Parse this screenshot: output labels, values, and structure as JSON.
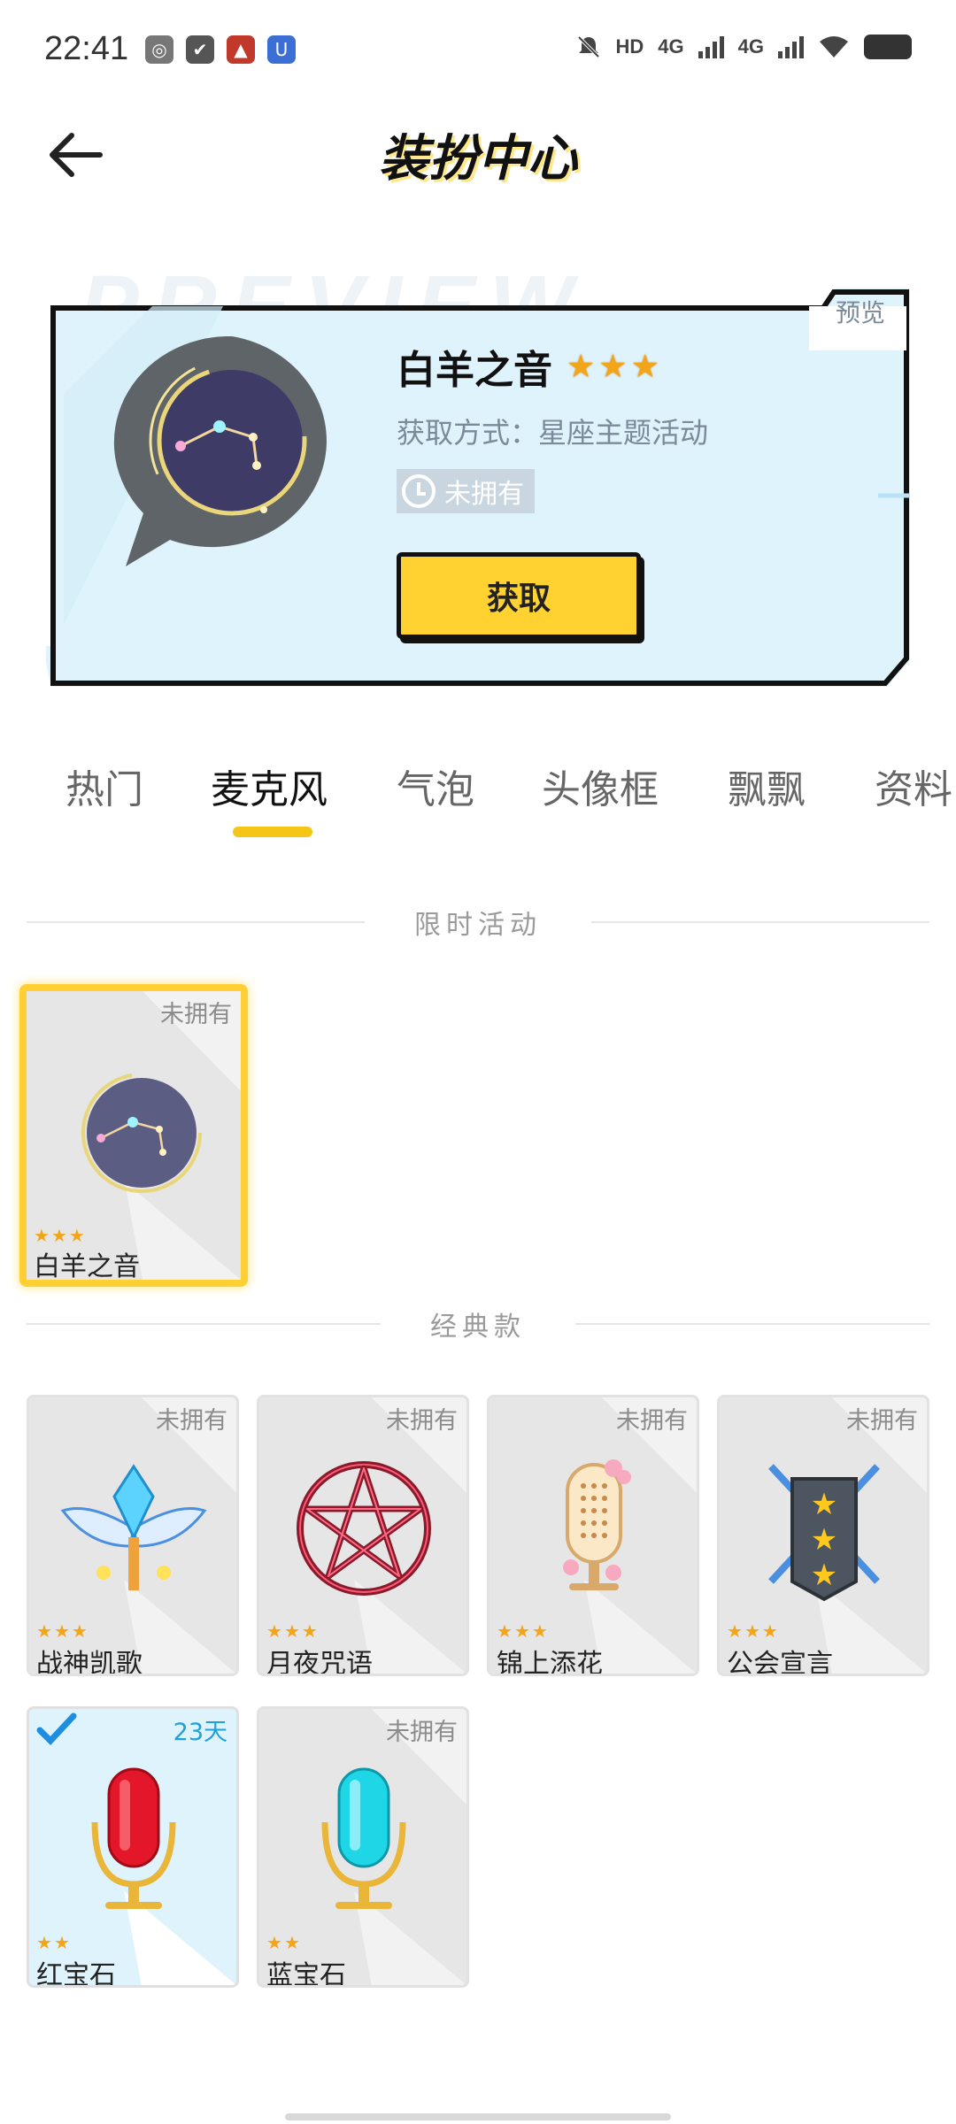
{
  "status_bar": {
    "time": "22:41",
    "hd_label": "HD",
    "net1": "4G",
    "net2": "4G"
  },
  "header": {
    "title": "装扮中心"
  },
  "preview_watermark": "PREVIEW",
  "preview": {
    "badge": "预览",
    "name": "白羊之音",
    "stars": 3,
    "method": "获取方式：星座主题活动",
    "owned_status": "未拥有",
    "obtain_button": "获取"
  },
  "tabs": [
    {
      "label": "热门",
      "active": false
    },
    {
      "label": "麦克风",
      "active": true
    },
    {
      "label": "气泡",
      "active": false
    },
    {
      "label": "头像框",
      "active": false
    },
    {
      "label": "飘飘",
      "active": false
    },
    {
      "label": "资料",
      "active": false
    }
  ],
  "sections": {
    "limited": {
      "label": "限时活动",
      "items": [
        {
          "name": "白羊之音",
          "badge": "未拥有",
          "stars": 3,
          "icon": "aries-constellation-icon"
        }
      ]
    },
    "classic": {
      "label": "经典款",
      "items": [
        {
          "name": "战神凯歌",
          "badge": "未拥有",
          "stars": 3,
          "icon": "winged-crystal-mic-icon"
        },
        {
          "name": "月夜咒语",
          "badge": "未拥有",
          "stars": 3,
          "icon": "pentagram-icon"
        },
        {
          "name": "锦上添花",
          "badge": "未拥有",
          "stars": 3,
          "icon": "flower-mic-icon"
        },
        {
          "name": "公会宣言",
          "badge": "未拥有",
          "stars": 3,
          "icon": "shield-swords-icon"
        },
        {
          "name": "红宝石",
          "badge": "23天",
          "stars": 2,
          "icon": "ruby-mic-icon"
        },
        {
          "name": "蓝宝石",
          "badge": "未拥有",
          "stars": 2,
          "icon": "sapphire-mic-icon"
        }
      ]
    }
  },
  "colors": {
    "accent": "#ffd232",
    "preview_bg": "#dff3fc",
    "star": "#f3a51a",
    "days_badge": "#1ea0d8"
  }
}
